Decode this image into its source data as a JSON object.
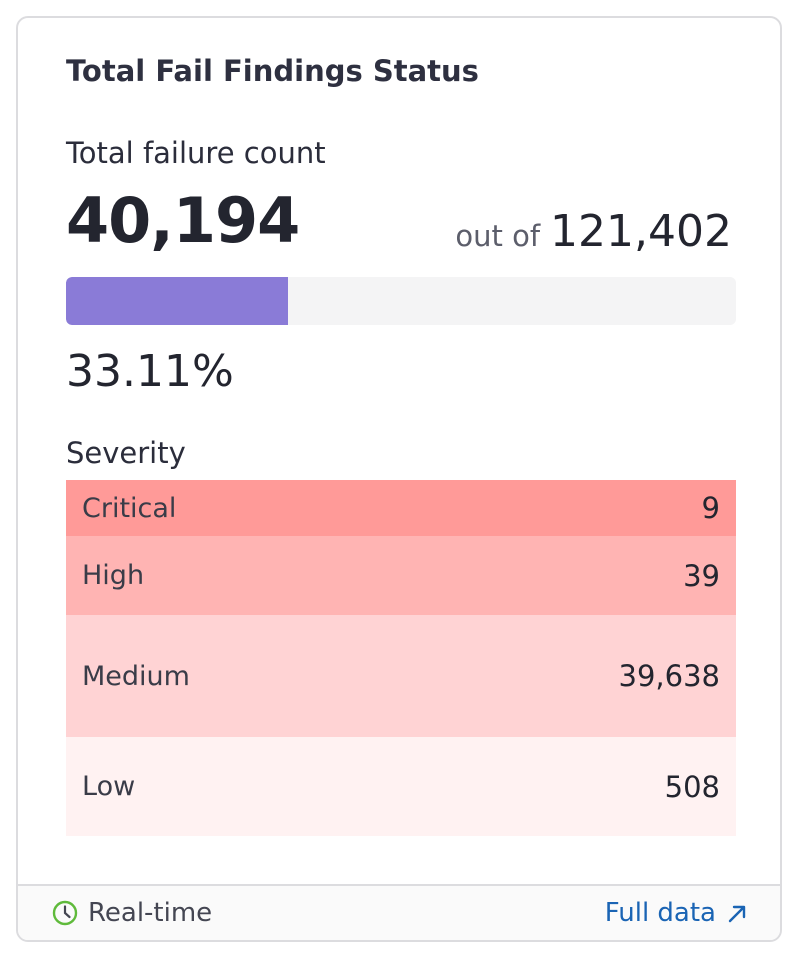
{
  "widget": {
    "title": "Total Fail Findings Status",
    "failure_label": "Total failure count",
    "failure_count": "40,194",
    "out_of_label": "out of",
    "total_count": "121,402",
    "progress_fraction": 0.3311,
    "percent_label": "33.11%",
    "bar_color": "#8a7bd7"
  },
  "severity": {
    "label": "Severity",
    "rows": [
      {
        "name": "Critical",
        "value": "9",
        "color": "#ff9a98"
      },
      {
        "name": "High",
        "value": "39",
        "color": "#ffb4b3"
      },
      {
        "name": "Medium",
        "value": "39,638",
        "color": "#ffd3d4"
      },
      {
        "name": "Low",
        "value": "508",
        "color": "#fff2f2"
      }
    ]
  },
  "footer": {
    "realtime_label": "Real-time",
    "realtime_icon": "clock-icon",
    "full_data_label": "Full data",
    "full_data_icon": "arrow-up-right-icon",
    "link_color": "#1a64b4"
  }
}
